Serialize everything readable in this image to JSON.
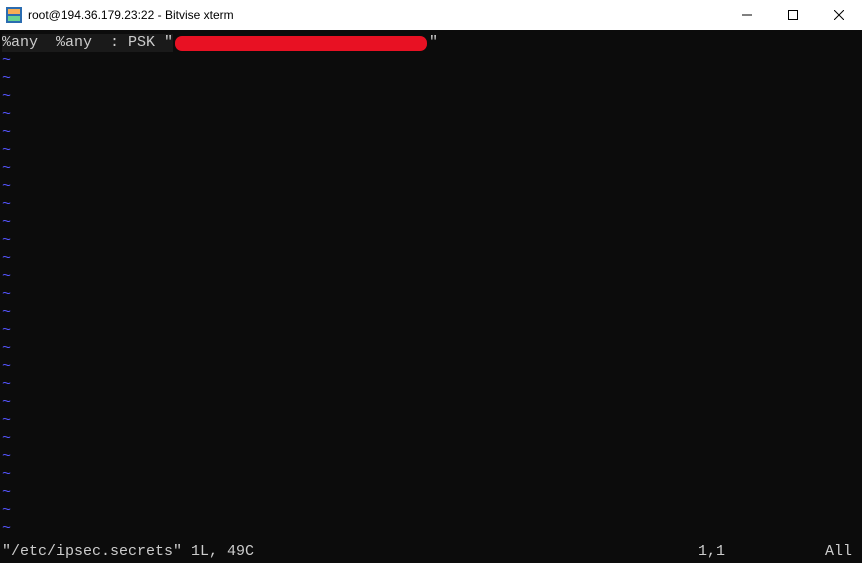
{
  "window": {
    "title": "root@194.36.179.23:22 - Bitvise xterm"
  },
  "editor": {
    "first_line_prefix": "%any  %any  : PSK \"",
    "first_line_suffix": "\"",
    "tilde": "~",
    "tilde_count": 27
  },
  "status": {
    "file_info": "\"/etc/ipsec.secrets\" 1L, 49C",
    "cursor_pos": "1,1",
    "scroll": "All"
  }
}
